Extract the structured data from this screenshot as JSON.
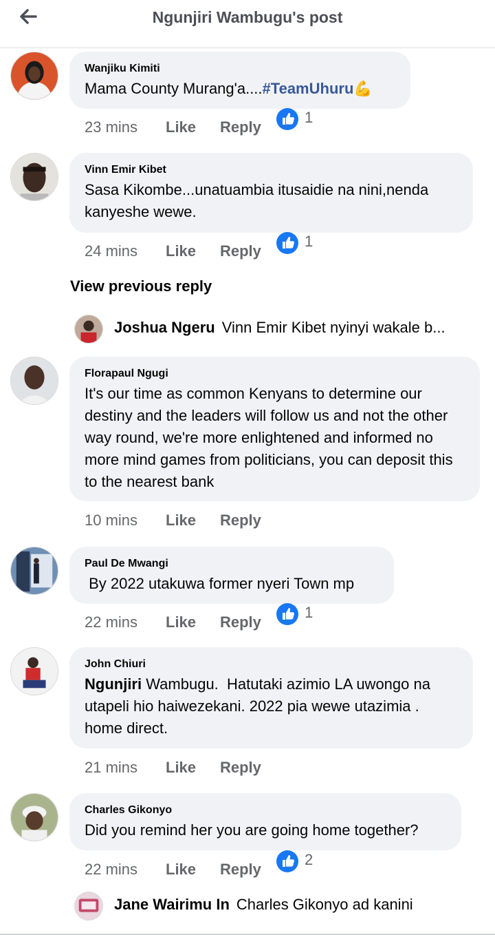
{
  "header": {
    "title": "Ngunjiri Wambugu's post"
  },
  "comments": [
    {
      "author": "Wanjiku Kimiti",
      "text": "Mama County Murang'a....",
      "hashtag": "#TeamUhuru",
      "emoji": "💪",
      "time": "23 mins",
      "like": "Like",
      "reply": "Reply",
      "reactions": "1"
    },
    {
      "author": "Vinn Emir Kibet",
      "text": "Sasa Kikombe...unatuambia itusaidie na nini,nenda kanyeshe wewe.",
      "time": "24 mins",
      "like": "Like",
      "reply": "Reply",
      "reactions": "1",
      "view_previous": "View previous reply",
      "reply_preview": {
        "name": "Joshua Ngeru",
        "text": "Vinn Emir Kibet nyinyi wakale b..."
      }
    },
    {
      "author": "Florapaul Ngugi",
      "text": "It's our time as common Kenyans to determine our destiny and the leaders will follow us and not the other way round, we're more enlightened and informed no more mind games from politicians, you can deposit this to the nearest bank",
      "time": "10 mins",
      "like": "Like",
      "reply": "Reply"
    },
    {
      "author": "Paul De Mwangi",
      "text": " By 2022 utakuwa former nyeri Town mp",
      "time": "22 mins",
      "like": "Like",
      "reply": "Reply",
      "reactions": "1"
    },
    {
      "author": "John Chiuri",
      "mention": "Ngunjiri",
      "text": " Wambugu.  Hatutaki azimio LA uwongo na utapeli hio haiwezekani. 2022 pia wewe utazimia . home direct.",
      "time": "21 mins",
      "like": "Like",
      "reply": "Reply"
    },
    {
      "author": "Charles Gikonyo",
      "text": "Did you remind her you are going home together?",
      "time": "22 mins",
      "like": "Like",
      "reply": "Reply",
      "reactions": "2",
      "reply_preview": {
        "name": "Jane Wairimu In",
        "text": "Charles Gikonyo ad kanini"
      }
    }
  ],
  "colors": {
    "bubble": "#f0f2f5",
    "meta": "#65676b",
    "hashtag": "#385898",
    "like_blue": "#1877f2"
  }
}
